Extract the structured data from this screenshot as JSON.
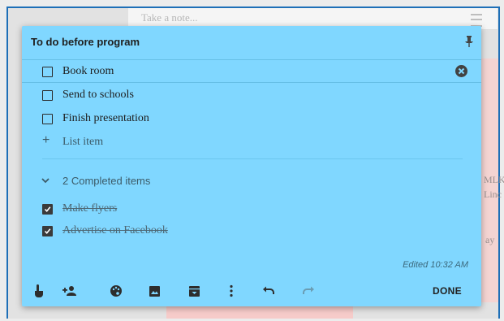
{
  "background": {
    "take_note_placeholder": "Take a note...",
    "right_text_1": "MLK",
    "right_text_2": "Linc",
    "right_text_3": "ay"
  },
  "note": {
    "title": "To do before program",
    "items": [
      {
        "label": "Book room",
        "checked": false
      },
      {
        "label": "Send to schools",
        "checked": false
      },
      {
        "label": "Finish presentation",
        "checked": false
      }
    ],
    "add_item_label": "List item",
    "completed_header": "2 Completed items",
    "completed_items": [
      {
        "label": "Make flyers",
        "checked": true
      },
      {
        "label": "Advertise on Facebook",
        "checked": true
      }
    ],
    "edited": "Edited 10:32 AM",
    "done_label": "DONE"
  },
  "toolbar_icons": [
    "remind-me-icon",
    "collaborator-icon",
    "palette-icon",
    "image-icon",
    "archive-icon",
    "more-icon",
    "undo-icon",
    "redo-icon"
  ],
  "colors": {
    "note_background": "#80d7ff",
    "frame_border": "#1e6fb7"
  }
}
